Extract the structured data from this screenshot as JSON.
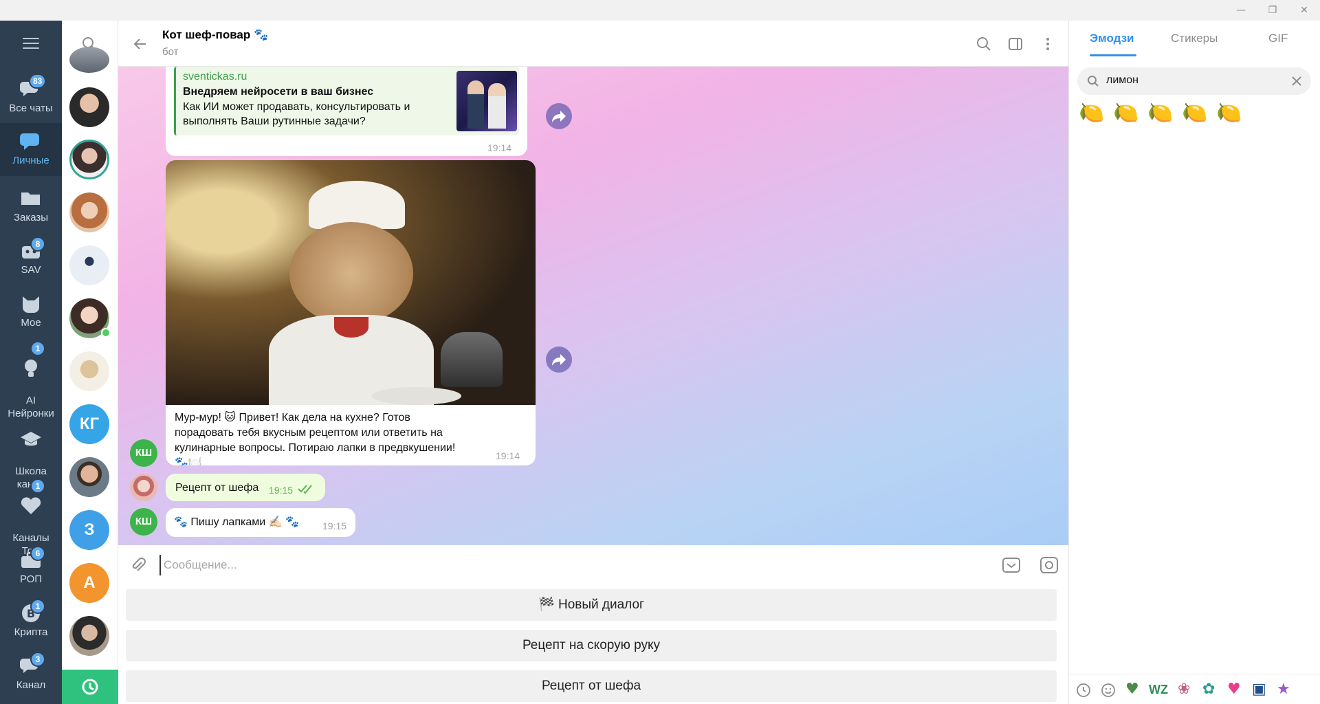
{
  "window": {
    "minimize_glyph": "—",
    "restore_glyph": "❐",
    "close_glyph": "✕"
  },
  "folders": [
    {
      "label": "Все чаты",
      "badge": "83",
      "icon": "chats-icon",
      "active": false
    },
    {
      "label": "Личные",
      "badge": "",
      "icon": "person-chat-icon",
      "active": true
    },
    {
      "label": "Заказы",
      "badge": "",
      "icon": "folder-icon",
      "active": false
    },
    {
      "label": "SAV",
      "badge": "8",
      "icon": "bot-folder-icon",
      "active": false
    },
    {
      "label": "Мое",
      "badge": "",
      "icon": "cat-icon",
      "active": false
    },
    {
      "label": "AI\nНейронки",
      "badge": "1",
      "icon": "bulb-icon",
      "active": false
    },
    {
      "label": "Школа\nканал",
      "badge": "",
      "icon": "graduation-cap-icon",
      "active": false
    },
    {
      "label": "Каналы\nТом",
      "badge": "1",
      "icon": "heart-icon",
      "active": false
    },
    {
      "label": "РОП",
      "badge": "6",
      "icon": "briefcase-icon",
      "active": false
    },
    {
      "label": "Крипта",
      "badge": "1",
      "icon": "bitcoin-icon",
      "active": false
    },
    {
      "label": "Канал",
      "badge": "3",
      "icon": "channel-icon",
      "active": false
    }
  ],
  "chatlist": {
    "letters": [
      "КГ",
      "З",
      "А"
    ],
    "colors": {
      "kg": "#35a5e8",
      "z": "#3fa0e8",
      "a": "#f2952e"
    }
  },
  "header": {
    "title": "Кот шеф-повар 🐾",
    "subtitle": "бот"
  },
  "messages": {
    "link_preview": {
      "site": "sventickas.ru",
      "title": "Внедряем нейросети в ваш бизнес",
      "description": "Как ИИ может продавать, консультировать и выполнять Ваши  рутинные задачи?",
      "time": "19:14"
    },
    "photo_caption": "Мур-мур! 🐱 Привет! Как дела на кухне? Готов порадовать тебя вкусным рецептом или ответить на кулинарные вопросы. Потираю лапки в предвкушении! 🐾🍽️",
    "photo_time": "19:14",
    "bot_avatar": "КШ",
    "outgoing": {
      "text": "Рецепт от шефа",
      "time": "19:15"
    },
    "reply": {
      "text": "🐾 Пишу лапками ✍🏻 🐾",
      "time": "19:15"
    }
  },
  "composer": {
    "placeholder": "Сообщение..."
  },
  "keyboard": {
    "buttons": [
      "🏁 Новый диалог",
      "Рецепт на скорую руку",
      "Рецепт от шефа"
    ]
  },
  "emoji_panel": {
    "tabs": [
      "Эмодзи",
      "Стикеры",
      "GIF"
    ],
    "active_tab": "Эмодзи",
    "search_value": "лимон",
    "results": [
      "🍋",
      "🍋",
      "🍋",
      "🍋",
      "🍋"
    ],
    "bottom_icons": [
      "recent-icon",
      "smile-icon",
      "sticker-pack-1",
      "sticker-pack-2",
      "sticker-pack-3",
      "sticker-pack-4",
      "sticker-pack-5",
      "sticker-pack-6",
      "sticker-pack-7"
    ],
    "accent": "#3390ec"
  }
}
